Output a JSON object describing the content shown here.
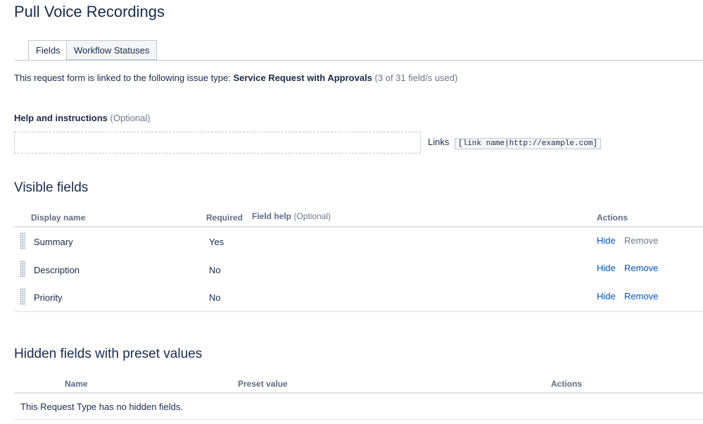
{
  "page": {
    "title": "Pull Voice Recordings"
  },
  "tabs": [
    {
      "label": "Fields",
      "active": true
    },
    {
      "label": "Workflow Statuses",
      "active": false
    }
  ],
  "linked": {
    "prefix": "This request form is linked to the following issue type: ",
    "issue_type": "Service Request with Approvals",
    "usage": "(3 of 31 field/s used)"
  },
  "help": {
    "label": "Help and instructions",
    "optional": "(Optional)",
    "value": "",
    "links_label": "Links",
    "links_example": "[link name|http://example.com]"
  },
  "visible_fields": {
    "title": "Visible fields",
    "headers": {
      "display_name": "Display name",
      "required": "Required",
      "field_help": "Field help",
      "field_help_optional": "(Optional)",
      "actions": "Actions"
    },
    "rows": [
      {
        "name": "Summary",
        "required": "Yes",
        "hide": "Hide",
        "remove": "Remove",
        "remove_enabled": false
      },
      {
        "name": "Description",
        "required": "No",
        "hide": "Hide",
        "remove": "Remove",
        "remove_enabled": true
      },
      {
        "name": "Priority",
        "required": "No",
        "hide": "Hide",
        "remove": "Remove",
        "remove_enabled": true
      }
    ]
  },
  "hidden_fields": {
    "title": "Hidden fields with preset values",
    "headers": {
      "name": "Name",
      "preset_value": "Preset value",
      "actions": "Actions"
    },
    "empty_message": "This Request Type has no hidden fields."
  },
  "colors": {
    "link": "#0052cc",
    "text": "#172b4d",
    "muted": "#6b778c",
    "border": "#c1c7d0"
  }
}
